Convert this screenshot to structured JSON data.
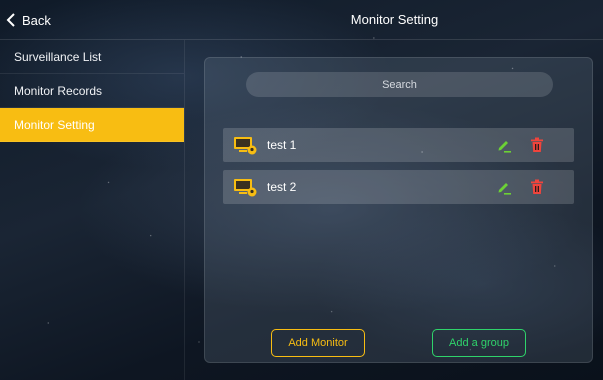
{
  "header": {
    "back_label": "Back",
    "title": "Monitor Setting"
  },
  "sidebar": {
    "items": [
      {
        "label": "Surveillance List",
        "active": false
      },
      {
        "label": "Monitor Records",
        "active": false
      },
      {
        "label": "Monitor Setting",
        "active": true
      }
    ]
  },
  "main": {
    "search": {
      "placeholder": "Search",
      "value": ""
    },
    "monitors": [
      {
        "name": "test 1",
        "icon": "monitor-location-icon"
      },
      {
        "name": "test 2",
        "icon": "monitor-location-icon"
      }
    ],
    "row_actions": {
      "edit_icon": "edit-icon",
      "delete_icon": "trash-icon"
    },
    "buttons": {
      "add_monitor": "Add Monitor",
      "add_group": "Add a group"
    }
  },
  "colors": {
    "accent": "#f8bd12",
    "edit": "#6cd135",
    "delete": "#f0443c",
    "group_button": "#2fd36b"
  }
}
